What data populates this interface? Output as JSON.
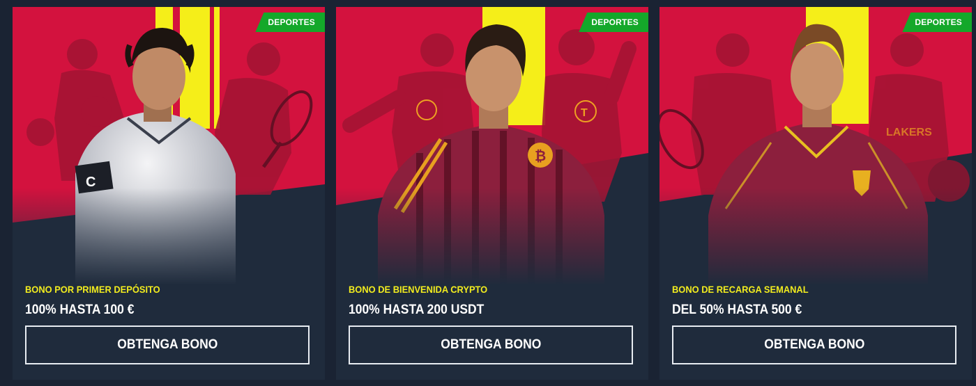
{
  "colors": {
    "page_bg": "#1a2333",
    "card_bg": "#1f2b3c",
    "art_red": "#d3123e",
    "art_yellow": "#f5ee19",
    "tag_green": "#14a82a",
    "subtitle_yellow": "#f2ec1e",
    "button_border": "#e8ecf2"
  },
  "cards": [
    {
      "tag": "DEPORTES",
      "subtitle": "BONO POR PRIMER DEPÓSITO",
      "headline": "100% HASTA 100 €",
      "button": "OBTENGA BONO",
      "art_icons": [
        "footballer-portrait",
        "boxer-figure",
        "tennis-player-figure"
      ]
    },
    {
      "tag": "DEPORTES",
      "subtitle": "BONO DE BIENVENIDA CRYPTO",
      "headline": "100% HASTA 200 USDT",
      "button": "OBTENGA BONO",
      "art_icons": [
        "footballer-bitcoin-jersey",
        "footballer-figure-left",
        "footballer-tether-figure"
      ]
    },
    {
      "tag": "DEPORTES",
      "subtitle": "BONO DE RECARGA SEMANAL",
      "headline": "DEL 50% HASTA 500 €",
      "button": "OBTENGA BONO",
      "art_icons": [
        "footballer-portrait",
        "tennis-player-figure",
        "basketball-player-figure"
      ]
    }
  ]
}
